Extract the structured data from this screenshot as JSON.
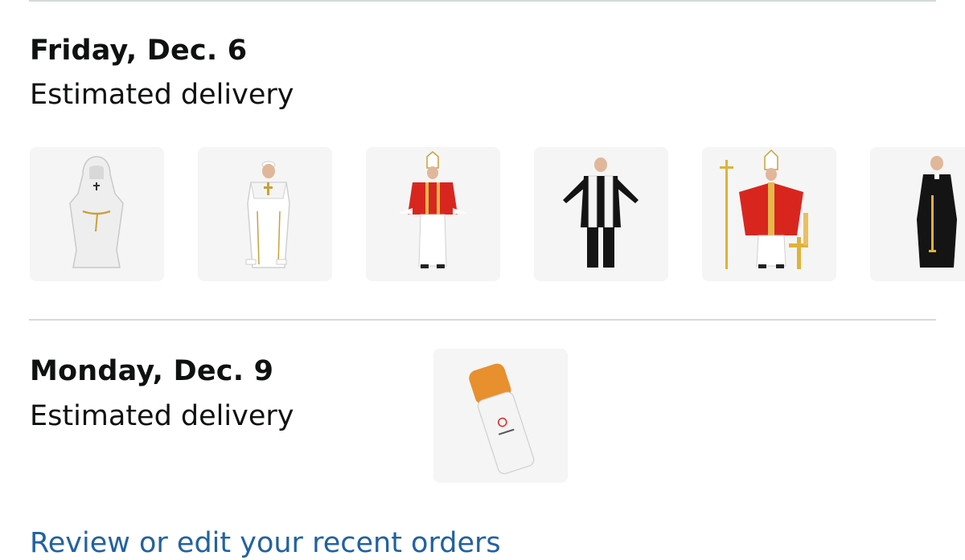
{
  "delivery_groups": [
    {
      "date": "Friday, Dec. 6",
      "status": "Estimated delivery",
      "items": [
        {
          "icon": "white-monk-robe-costume"
        },
        {
          "icon": "white-pope-costume"
        },
        {
          "icon": "red-cardinal-costume"
        },
        {
          "icon": "black-priest-stole-costume"
        },
        {
          "icon": "red-bishop-costume-with-staff"
        },
        {
          "icon": "black-priest-cassock-costume"
        }
      ]
    },
    {
      "date": "Monday, Dec. 9",
      "status": "Estimated delivery",
      "items": [
        {
          "icon": "cigarette-pillow"
        }
      ]
    }
  ],
  "links": {
    "review_orders": "Review or edit your recent orders"
  },
  "colors": {
    "link": "#2162a1",
    "text": "#0f1111",
    "divider": "#d5d9d9",
    "thumb_bg": "#f5f5f5"
  }
}
